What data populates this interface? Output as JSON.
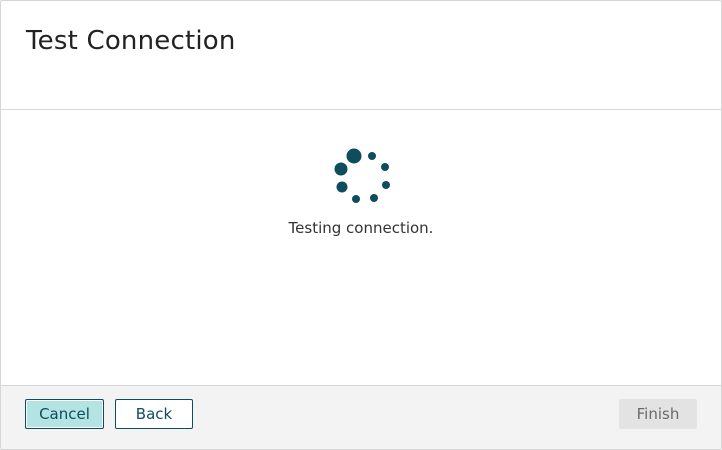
{
  "dialog": {
    "title": "Test Connection",
    "status_text": "Testing connection.",
    "spinner_icon": "loading-spinner-icon",
    "accent_color": "#0f4d5c"
  },
  "footer": {
    "cancel_label": "Cancel",
    "back_label": "Back",
    "finish_label": "Finish",
    "finish_disabled": true
  }
}
